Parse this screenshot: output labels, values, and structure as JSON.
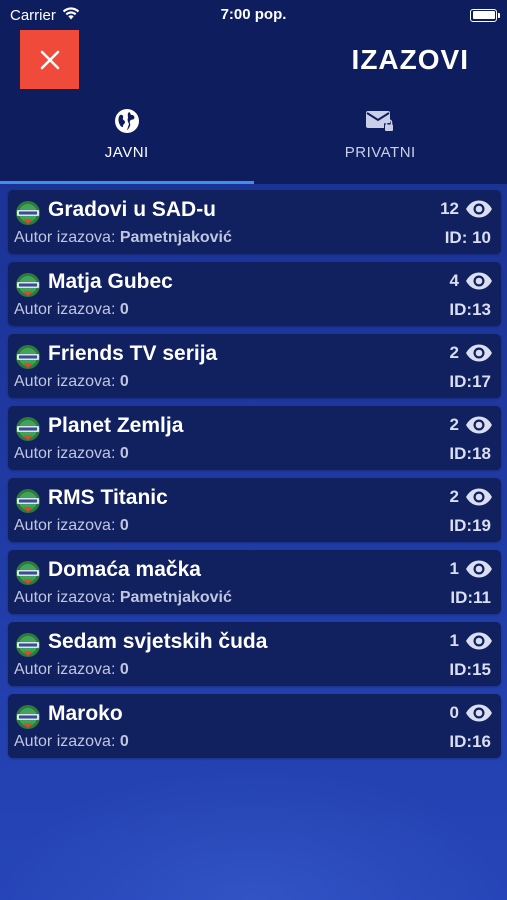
{
  "status": {
    "carrier": "Carrier",
    "time": "7:00 pop."
  },
  "header": {
    "title": "IZAZOVI"
  },
  "tabs": [
    {
      "label": "JAVNI",
      "icon": "globe-icon",
      "active": true
    },
    {
      "label": "PRIVATNI",
      "icon": "mail-lock-icon",
      "active": false
    }
  ],
  "author_prefix": "Autor izazova: ",
  "items": [
    {
      "title": "Gradovi u SAD-u",
      "author": "Pametnjaković",
      "views": "12",
      "id": "ID: 10"
    },
    {
      "title": "Matja Gubec",
      "author": "0",
      "views": "4",
      "id": "ID:13"
    },
    {
      "title": "Friends TV serija",
      "author": "0",
      "views": "2",
      "id": "ID:17"
    },
    {
      "title": "Planet Zemlja",
      "author": "0",
      "views": "2",
      "id": "ID:18"
    },
    {
      "title": "RMS Titanic",
      "author": "0",
      "views": "2",
      "id": "ID:19"
    },
    {
      "title": "Domaća mačka",
      "author": "Pametnjaković",
      "views": "1",
      "id": "ID:11"
    },
    {
      "title": "Sedam svjetskih čuda",
      "author": "0",
      "views": "1",
      "id": "ID:15"
    },
    {
      "title": "Maroko",
      "author": "0",
      "views": "0",
      "id": "ID:16"
    }
  ],
  "colors": {
    "close": "#ef4a3a",
    "header_bg": "#0d1d5e",
    "card_bg": "#11205f",
    "tab_indicator": "#3f8ef0"
  }
}
